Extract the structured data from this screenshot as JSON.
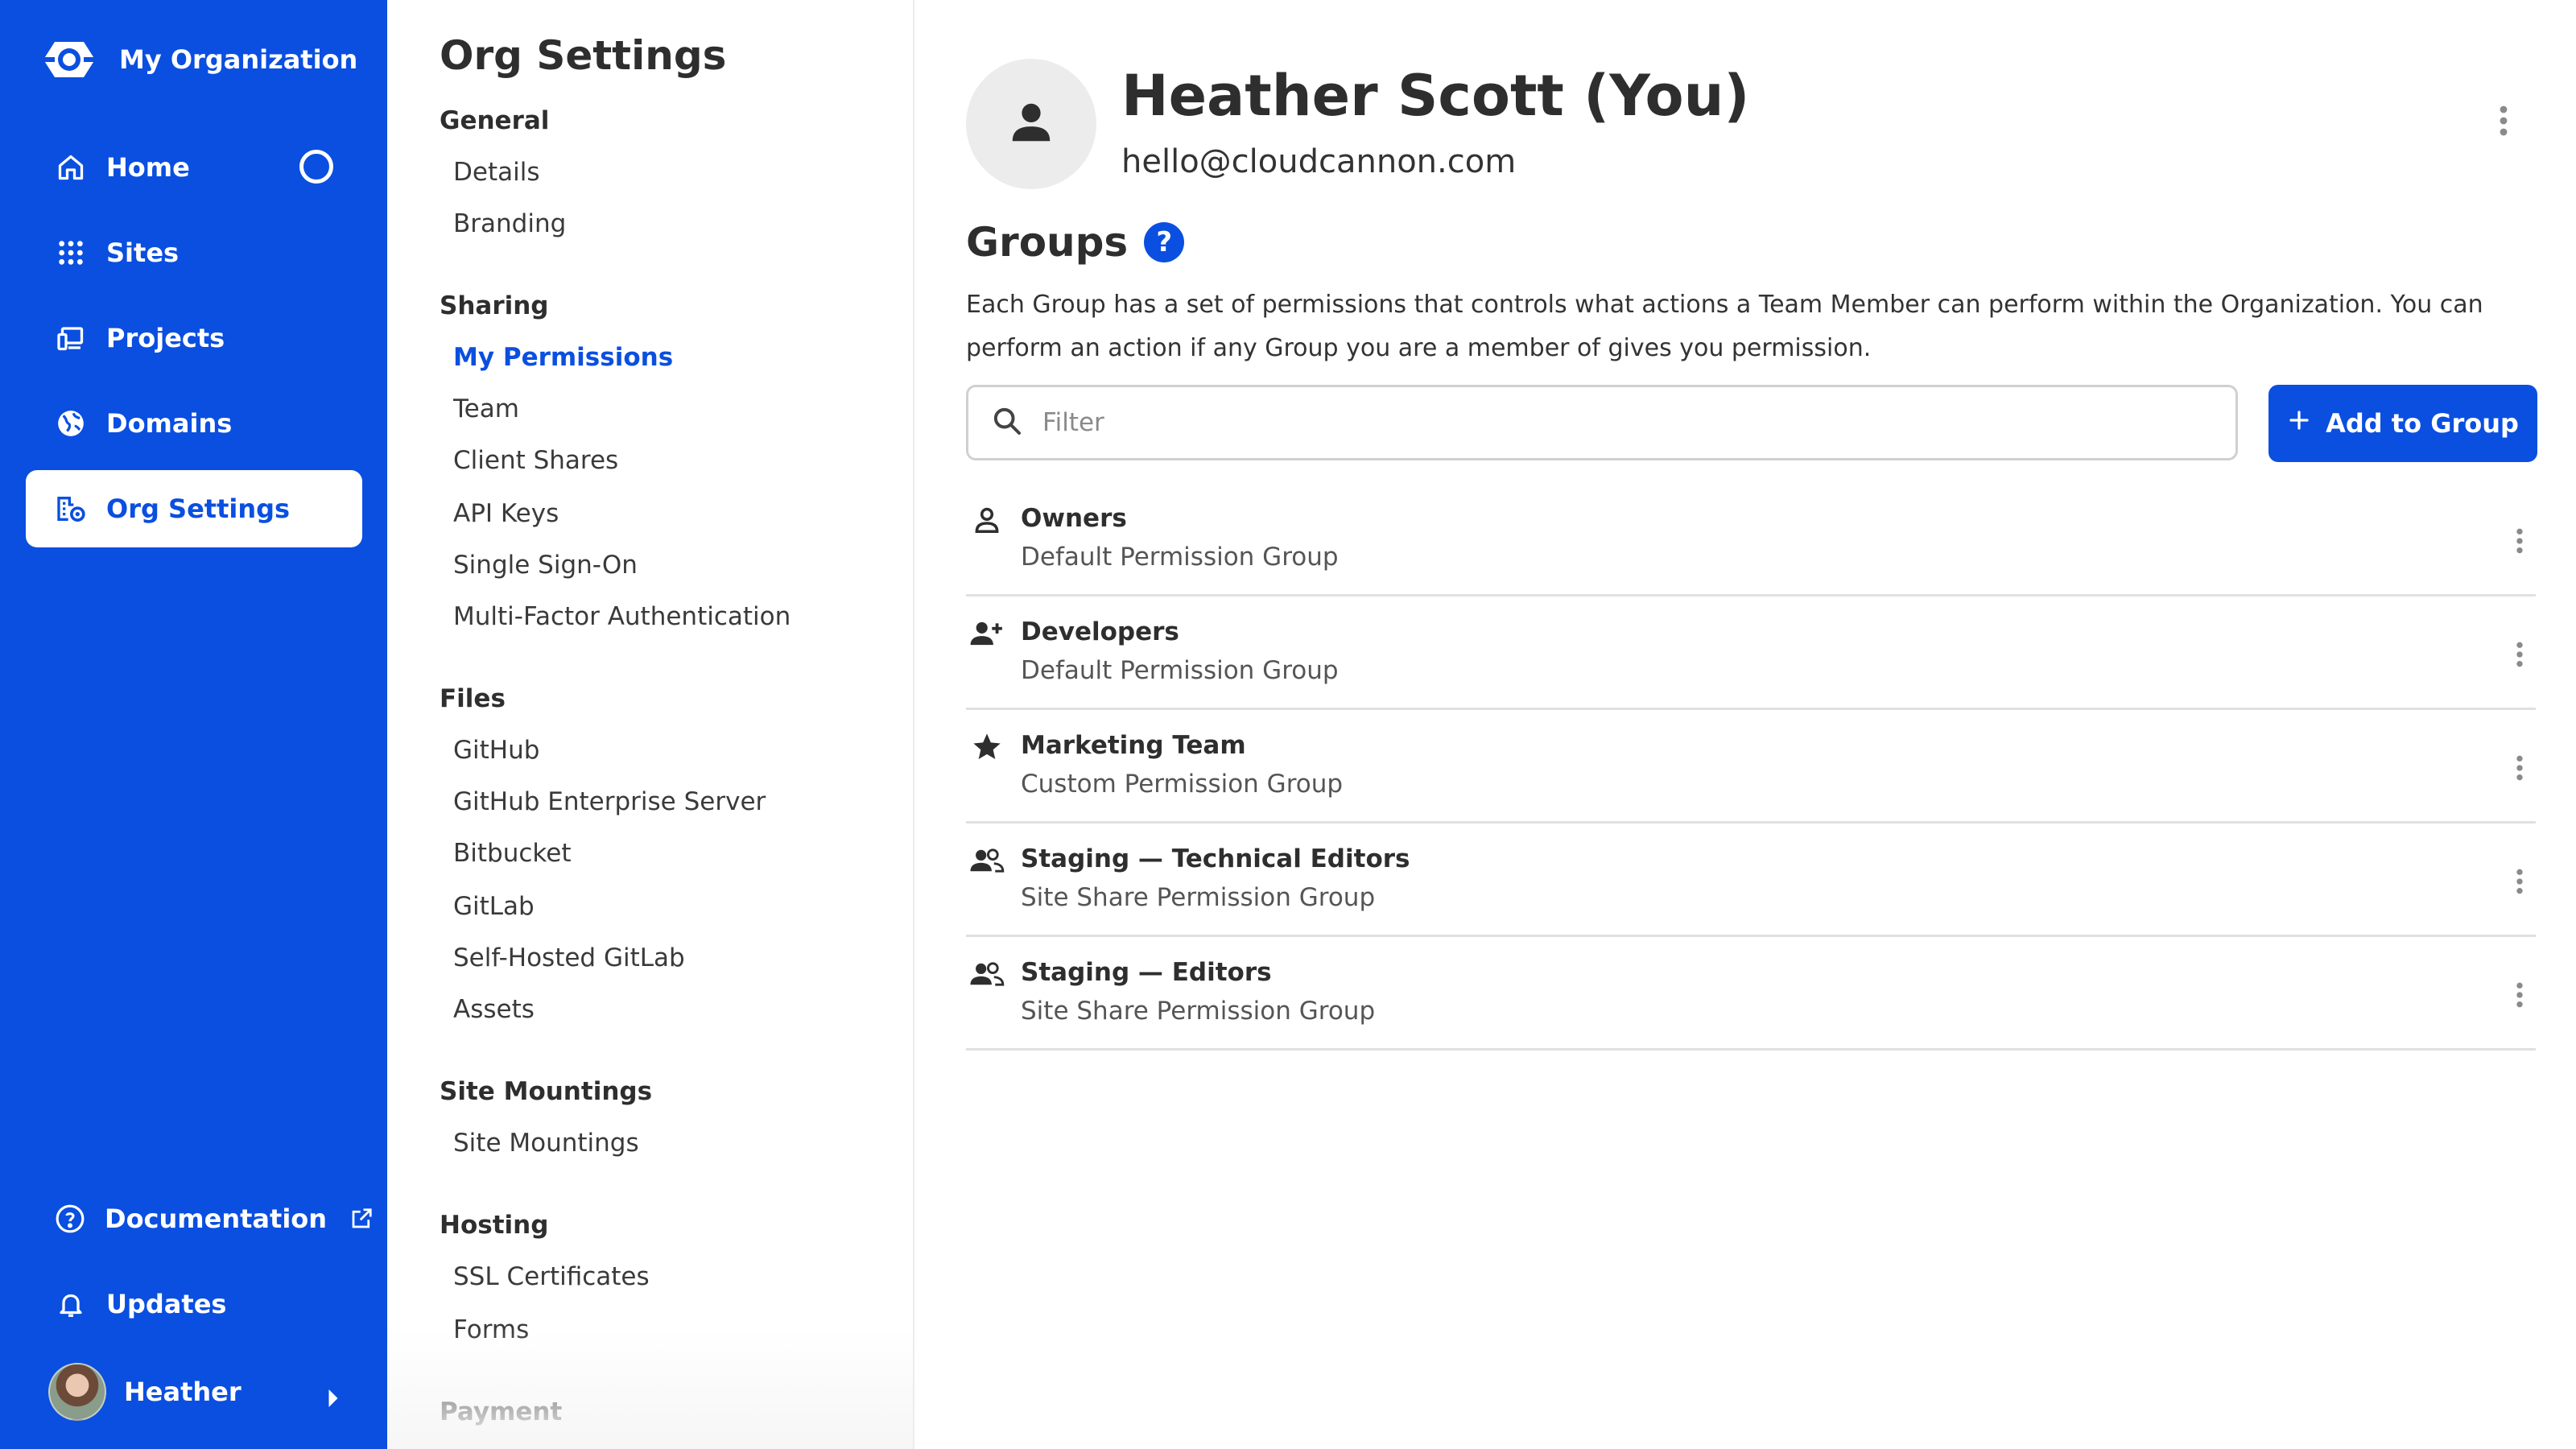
{
  "nav": {
    "org_name": "My Organization",
    "items": [
      {
        "label": "Home",
        "icon": "home-icon"
      },
      {
        "label": "Sites",
        "icon": "grid-icon"
      },
      {
        "label": "Projects",
        "icon": "devices-icon"
      },
      {
        "label": "Domains",
        "icon": "globe-icon"
      },
      {
        "label": "Org Settings",
        "icon": "building-settings-icon",
        "active": true
      }
    ],
    "bottom": [
      {
        "label": "Documentation",
        "icon": "help-circle-icon"
      },
      {
        "label": "Updates",
        "icon": "bell-icon"
      }
    ],
    "user": {
      "name": "Heather"
    },
    "accent": "#0a4fe0"
  },
  "settings": {
    "title": "Org Settings",
    "sections": [
      {
        "heading": "General",
        "links": [
          "Details",
          "Branding"
        ]
      },
      {
        "heading": "Sharing",
        "links": [
          "My Permissions",
          "Team",
          "Client Shares",
          "API Keys",
          "Single Sign-On",
          "Multi-Factor Authentication"
        ]
      },
      {
        "heading": "Files",
        "links": [
          "GitHub",
          "GitHub Enterprise Server",
          "Bitbucket",
          "GitLab",
          "Self-Hosted GitLab",
          "Assets"
        ]
      },
      {
        "heading": "Site Mountings",
        "links": [
          "Site Mountings"
        ]
      },
      {
        "heading": "Hosting",
        "links": [
          "SSL Certificates",
          "Forms"
        ]
      },
      {
        "heading": "Payment",
        "links": []
      }
    ],
    "active_link": "My Permissions"
  },
  "profile": {
    "name": "Heather Scott (You)",
    "email": "hello@cloudcannon.com"
  },
  "groups": {
    "title": "Groups",
    "help_label": "?",
    "description": "Each Group has a set of permissions that controls what actions a Team Member can perform within the Organization. You can perform an action if any Group you are a member of gives you permission.",
    "filter_placeholder": "Filter",
    "filter_value": "",
    "add_button_label": "Add to Group",
    "items": [
      {
        "name": "Owners",
        "type": "Default Permission Group",
        "icon": "person-outline-icon"
      },
      {
        "name": "Developers",
        "type": "Default Permission Group",
        "icon": "person-add-icon"
      },
      {
        "name": "Marketing Team",
        "type": "Custom Permission Group",
        "icon": "star-icon"
      },
      {
        "name": "Staging — Technical Editors",
        "type": "Site Share Permission Group",
        "icon": "people-icon"
      },
      {
        "name": "Staging — Editors",
        "type": "Site Share Permission Group",
        "icon": "people-icon"
      }
    ]
  }
}
